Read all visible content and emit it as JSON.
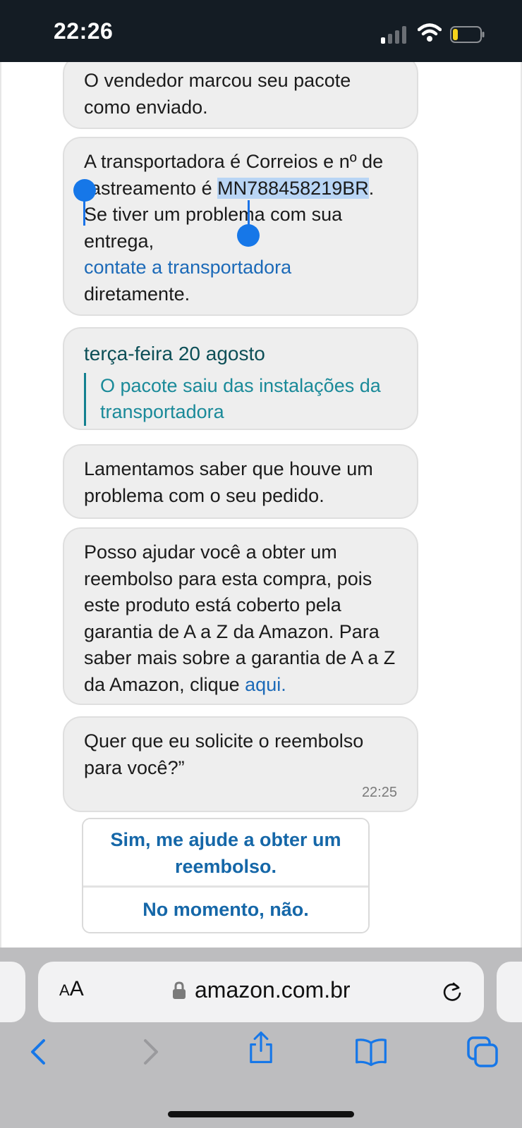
{
  "status_bar": {
    "time": "22:26"
  },
  "chat": {
    "messages": [
      {
        "text": "O vendedor marcou seu pacote como enviado."
      },
      {
        "part1": "A transportadora é Correios e nº de rastreamento é ",
        "tracking_number": "MN788458219BR",
        "part2": ". Se tiver um problema com sua entrega,",
        "link_text": "contate a transportadora",
        "part3": "diretamente."
      },
      {
        "date": "terça-feira 20 agosto",
        "status": "O pacote saiu das instalações da transportadora"
      },
      {
        "text": "Lamentamos saber que houve um problema com o seu pedido."
      },
      {
        "text": "Posso ajudar você a obter um reembolso para esta compra, pois este produto está coberto pela garantia de A a Z da Amazon. Para saber mais sobre a garantia de A a Z da Amazon, clique ",
        "link_text": "aqui."
      },
      {
        "text": "Quer que eu solicite o reembolso para você?”",
        "time": "22:25"
      }
    ],
    "quick_replies": [
      "Sim, me ajude a obter um reembolso.",
      "No momento, não."
    ]
  },
  "browser": {
    "aa_small": "A",
    "aa_large": "A",
    "url": "amazon.com.br"
  },
  "colors": {
    "link": "#1c6ab8",
    "teal": "#127b8a",
    "selection": "#b9d5f5",
    "ios_blue": "#1677e8"
  }
}
